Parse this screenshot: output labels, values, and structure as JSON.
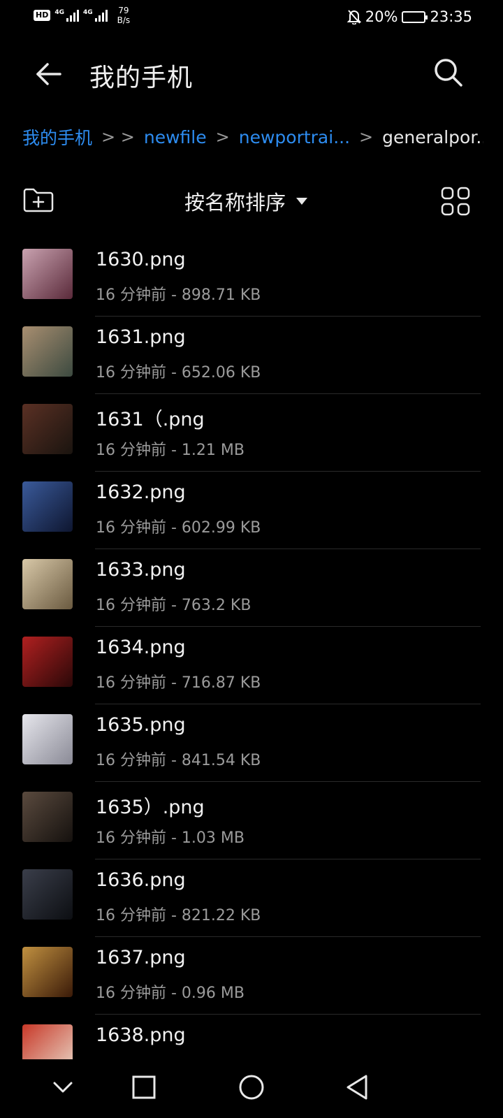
{
  "status_bar": {
    "hd": "HD",
    "network_1": "4G",
    "network_2": "4G",
    "speed_value": "79",
    "speed_unit": "B/s",
    "battery": "20%",
    "battery_level": 0.2,
    "time": "23:35"
  },
  "toolbar": {
    "title": "我的手机"
  },
  "breadcrumb": {
    "items": [
      "我的手机",
      "newfile",
      "newportrai...",
      "generalpor..."
    ]
  },
  "actions": {
    "sort_label": "按名称排序"
  },
  "files": [
    {
      "name": "1630.png",
      "meta": "16 分钟前 - 898.71 KB",
      "thumb_colors": [
        "#c9a2b0",
        "#5a2a3a"
      ]
    },
    {
      "name": "1631.png",
      "meta": "16 分钟前 - 652.06 KB",
      "thumb_colors": [
        "#a88e70",
        "#3c4a40"
      ]
    },
    {
      "name": "1631（.png",
      "meta": "16 分钟前 - 1.21 MB",
      "thumb_colors": [
        "#5a3024",
        "#1a140f"
      ]
    },
    {
      "name": "1632.png",
      "meta": "16 分钟前 - 602.99 KB",
      "thumb_colors": [
        "#3a5a9a",
        "#0e1630"
      ]
    },
    {
      "name": "1633.png",
      "meta": "16 分钟前 - 763.2 KB",
      "thumb_colors": [
        "#d8c8a8",
        "#6a5a40"
      ]
    },
    {
      "name": "1634.png",
      "meta": "16 分钟前 - 716.87 KB",
      "thumb_colors": [
        "#b02020",
        "#2a0808"
      ]
    },
    {
      "name": "1635.png",
      "meta": "16 分钟前 - 841.54 KB",
      "thumb_colors": [
        "#e6e6ec",
        "#8a8a96"
      ]
    },
    {
      "name": "1635）.png",
      "meta": "16 分钟前 - 1.03 MB",
      "thumb_colors": [
        "#5a4a3e",
        "#15110e"
      ]
    },
    {
      "name": "1636.png",
      "meta": "16 分钟前 - 821.22 KB",
      "thumb_colors": [
        "#3a3e4a",
        "#0c0e12"
      ]
    },
    {
      "name": "1637.png",
      "meta": "16 分钟前 - 0.96 MB",
      "thumb_colors": [
        "#c09040",
        "#3a1a08"
      ]
    },
    {
      "name": "1638.png",
      "meta": "",
      "thumb_colors": [
        "#c83828",
        "#e8d8c8"
      ]
    }
  ],
  "icons": {
    "back": "arrow-left-icon",
    "search": "search-icon",
    "new_folder": "folder-add-icon",
    "sort_caret": "caret-down-icon",
    "view_toggle": "grid-view-icon",
    "nav_collapse": "chevron-down-icon",
    "nav_recents": "square-icon",
    "nav_home": "circle-icon",
    "nav_back": "triangle-back-icon"
  }
}
